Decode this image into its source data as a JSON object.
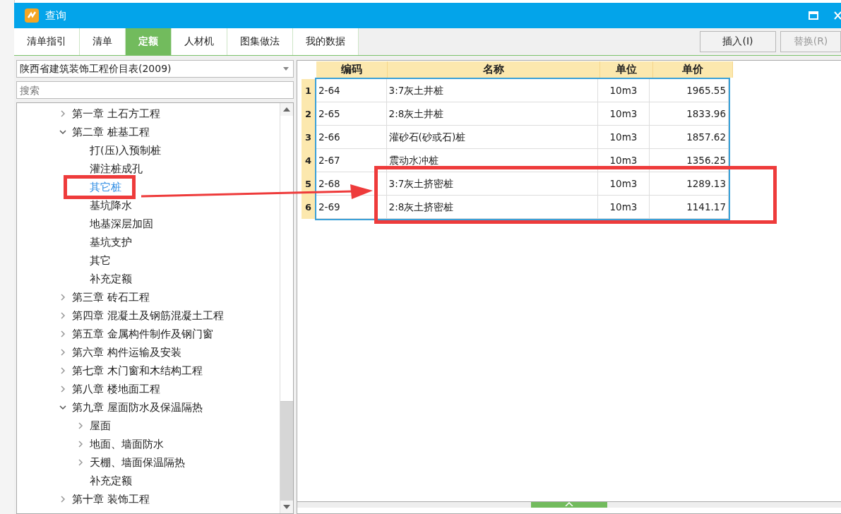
{
  "window": {
    "title": "查询"
  },
  "tabs": [
    {
      "label": "清单指引",
      "selected": false
    },
    {
      "label": "清单",
      "selected": false
    },
    {
      "label": "定额",
      "selected": true
    },
    {
      "label": "人材机",
      "selected": false
    },
    {
      "label": "图集做法",
      "selected": false
    },
    {
      "label": "我的数据",
      "selected": false
    }
  ],
  "buttons": [
    {
      "label": "插入(I)",
      "disabled": false
    },
    {
      "label": "替换(R)",
      "disabled": true
    }
  ],
  "library_select": {
    "value": "陕西省建筑装饰工程价目表(2009)"
  },
  "search": {
    "placeholder": "搜索"
  },
  "tree": [
    {
      "label": "第一章 土石方工程",
      "expanded": false,
      "selected": false
    },
    {
      "label": "第二章 桩基工程",
      "expanded": true,
      "selected": false,
      "children": [
        {
          "label": "打(压)入预制桩",
          "selected": false
        },
        {
          "label": "灌注桩成孔",
          "selected": false
        },
        {
          "label": "其它桩",
          "selected": true
        },
        {
          "label": "基坑降水",
          "selected": false
        },
        {
          "label": "地基深层加固",
          "selected": false
        },
        {
          "label": "基坑支护",
          "selected": false
        },
        {
          "label": "其它",
          "selected": false
        },
        {
          "label": "补充定额",
          "selected": false
        }
      ]
    },
    {
      "label": "第三章 砖石工程",
      "expanded": false,
      "selected": false
    },
    {
      "label": "第四章 混凝土及钢筋混凝土工程",
      "expanded": false,
      "selected": false
    },
    {
      "label": "第五章 金属构件制作及钢门窗",
      "expanded": false,
      "selected": false
    },
    {
      "label": "第六章 构件运输及安装",
      "expanded": false,
      "selected": false
    },
    {
      "label": "第七章 木门窗和木结构工程",
      "expanded": false,
      "selected": false
    },
    {
      "label": "第八章 楼地面工程",
      "expanded": false,
      "selected": false
    },
    {
      "label": "第九章 屋面防水及保温隔热",
      "expanded": true,
      "selected": false,
      "children": [
        {
          "label": "屋面",
          "expanded": false,
          "selected": false
        },
        {
          "label": "地面、墙面防水",
          "expanded": false,
          "selected": false
        },
        {
          "label": "天棚、墙面保温隔热",
          "expanded": false,
          "selected": false
        },
        {
          "label": "补充定额",
          "selected": false
        }
      ]
    },
    {
      "label": "第十章 装饰工程",
      "expanded": false,
      "selected": false
    }
  ],
  "table": {
    "columns": [
      "编码",
      "名称",
      "单位",
      "单价"
    ],
    "rows": [
      {
        "index": "1",
        "cells": [
          "2-64",
          "3:7灰土井桩",
          "10m3",
          "1965.55"
        ]
      },
      {
        "index": "2",
        "cells": [
          "2-65",
          "2:8灰土井桩",
          "10m3",
          "1833.96"
        ]
      },
      {
        "index": "3",
        "cells": [
          "2-66",
          "灌砂石(砂或石)桩",
          "10m3",
          "1857.62"
        ]
      },
      {
        "index": "4",
        "cells": [
          "2-67",
          "震动水冲桩",
          "10m3",
          "1356.25"
        ]
      },
      {
        "index": "5",
        "cells": [
          "2-68",
          "3:7灰土挤密桩",
          "10m3",
          "1289.13"
        ]
      },
      {
        "index": "6",
        "cells": [
          "2-69",
          "2:8灰土挤密桩",
          "10m3",
          "1141.17"
        ]
      }
    ]
  }
}
